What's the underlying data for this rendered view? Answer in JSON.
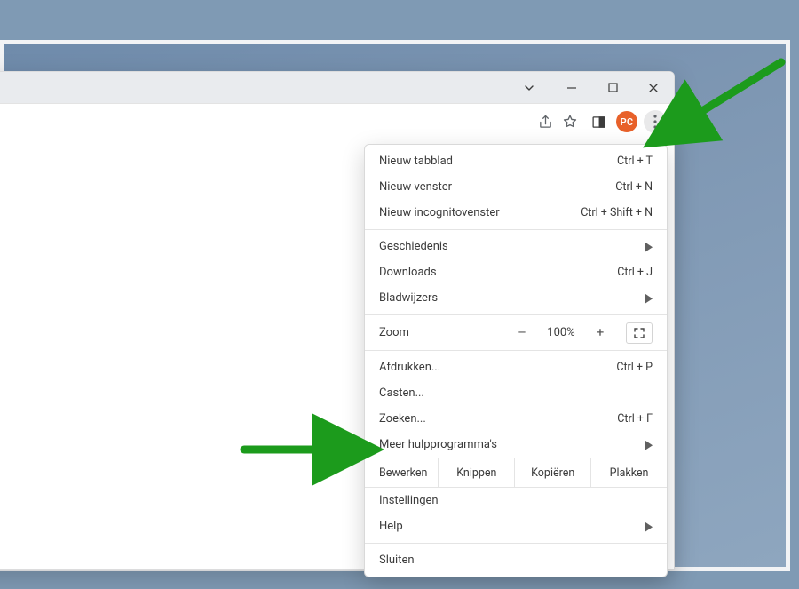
{
  "profile_initials": "PC",
  "window_controls": {
    "minimize": "–",
    "maximize": "☐",
    "close": "✕",
    "tab_chevron": "⌄"
  },
  "menu": {
    "new_tab": {
      "label": "Nieuw tabblad",
      "shortcut": "Ctrl + T"
    },
    "new_window": {
      "label": "Nieuw venster",
      "shortcut": "Ctrl + N"
    },
    "new_incognito": {
      "label": "Nieuw incognitovenster",
      "shortcut": "Ctrl + Shift + N"
    },
    "history": {
      "label": "Geschiedenis"
    },
    "downloads": {
      "label": "Downloads",
      "shortcut": "Ctrl + J"
    },
    "bookmarks": {
      "label": "Bladwijzers"
    },
    "zoom": {
      "label": "Zoom",
      "value": "100%",
      "minus": "–",
      "plus": "+"
    },
    "print": {
      "label": "Afdrukken...",
      "shortcut": "Ctrl + P"
    },
    "cast": {
      "label": "Casten..."
    },
    "find": {
      "label": "Zoeken...",
      "shortcut": "Ctrl + F"
    },
    "more_tools": {
      "label": "Meer hulpprogramma's"
    },
    "edit": {
      "label": "Bewerken",
      "cut": "Knippen",
      "copy": "Kopiëren",
      "paste": "Plakken"
    },
    "settings": {
      "label": "Instellingen"
    },
    "help": {
      "label": "Help"
    },
    "exit": {
      "label": "Sluiten"
    }
  },
  "annotation_color": "#1c9b1c"
}
